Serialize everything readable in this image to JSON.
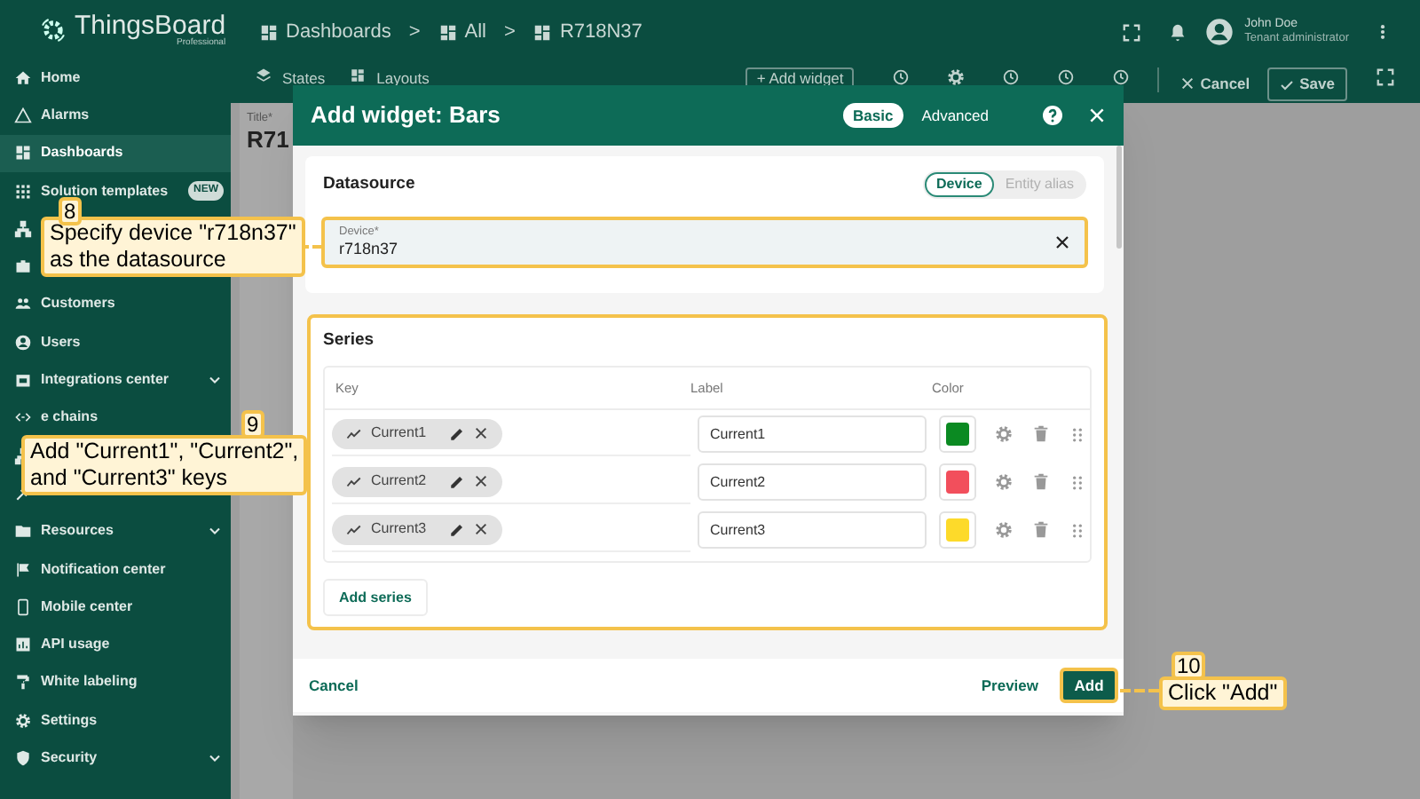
{
  "app": {
    "logo": "ThingsBoard",
    "edition": "Professional"
  },
  "breadcrumbs": [
    {
      "kind": "crumb",
      "label": "Dashboards"
    },
    {
      "kind": "separator",
      "label": ">"
    },
    {
      "kind": "crumb",
      "label": "All"
    },
    {
      "kind": "separator",
      "label": ">"
    },
    {
      "kind": "crumb",
      "label": "R718N37"
    }
  ],
  "user": {
    "name": "John Doe",
    "role": "Tenant administrator"
  },
  "sidebar": {
    "items": [
      {
        "label": "Home",
        "selected": false,
        "expandable": false
      },
      {
        "label": "Alarms",
        "selected": false,
        "expandable": false
      },
      {
        "label": "Dashboards",
        "selected": true,
        "expandable": false
      },
      {
        "label": "Solution templates",
        "selected": false,
        "expandable": false,
        "badge": "NEW"
      },
      {
        "selected": false
      },
      {
        "selected": false
      },
      {
        "label": "Customers",
        "selected": false,
        "expandable": false
      },
      {
        "label": "Users",
        "selected": false,
        "expandable": false
      },
      {
        "label": "Integrations center",
        "selected": false,
        "expandable": true
      },
      {
        "label": "e chains",
        "selected": false,
        "expandable": false
      },
      {
        "selected": false
      },
      {
        "selected": false
      },
      {
        "label": "Resources",
        "selected": false,
        "expandable": true
      },
      {
        "label": "Notification center",
        "selected": false,
        "expandable": false
      },
      {
        "label": "Mobile center",
        "selected": false,
        "expandable": false
      },
      {
        "label": "API usage",
        "selected": false,
        "expandable": false
      },
      {
        "label": "White labeling",
        "selected": false,
        "expandable": false
      },
      {
        "label": "Settings",
        "selected": false,
        "expandable": false
      },
      {
        "label": "Security",
        "selected": false,
        "expandable": true
      }
    ]
  },
  "toolbar": {
    "tabs": [
      "States",
      "Layouts"
    ],
    "add_widget": "+ Add widget",
    "cancel": "Cancel",
    "save": "Save"
  },
  "background": {
    "title_label": "Title*",
    "title_value": "R71"
  },
  "dialog": {
    "title": "Add widget: Bars",
    "modes": [
      {
        "label": "Basic",
        "selected": true
      },
      {
        "label": "Advanced",
        "selected": false
      }
    ],
    "datasource": {
      "heading": "Datasource",
      "types": [
        {
          "label": "Device",
          "selected": true
        },
        {
          "label": "Entity alias",
          "selected": false
        }
      ],
      "device_label": "Device*",
      "device_value": "r718n37"
    },
    "series": {
      "heading": "Series",
      "columns": [
        "Key",
        "Label",
        "Color"
      ],
      "rows": [
        {
          "key": "Current1",
          "label": "Current1",
          "color": "#0b8a22"
        },
        {
          "key": "Current2",
          "label": "Current2",
          "color": "#f24f5c"
        },
        {
          "key": "Current3",
          "label": "Current3",
          "color": "#fdda2a"
        }
      ],
      "add_button": "Add series"
    },
    "footer": {
      "cancel": "Cancel",
      "preview": "Preview",
      "add": "Add"
    }
  },
  "callouts": [
    {
      "number": "8",
      "lines": [
        "Specify device \"r718n37\"",
        "as the datasource"
      ]
    },
    {
      "number": "9",
      "lines": [
        "Add \"Current1\", \"Current2\",",
        "and \"Current3\" keys"
      ]
    },
    {
      "number": "10",
      "lines": [
        "Click \"Add\""
      ]
    }
  ]
}
